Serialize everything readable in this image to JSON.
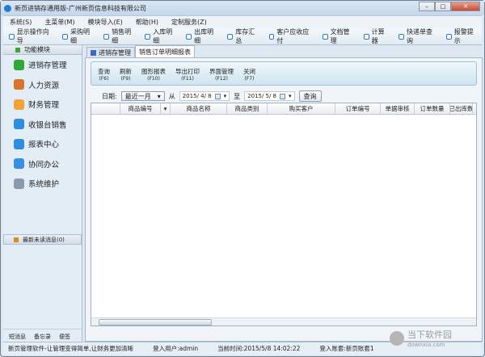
{
  "window": {
    "title": "新页进销存通用版-广州新页信息科技有限公司"
  },
  "menu": [
    "系统(S)",
    "主菜单(M)",
    "模块导入(E)",
    "帮助(H)",
    "定制服务(Z)"
  ],
  "toolbar": [
    "显示操作向导",
    "采购明细",
    "销售明细",
    "入库明细",
    "出库明细",
    "库存汇总",
    "客户应收应付",
    "文档管理",
    "计算器",
    "快递单查询",
    "报警提示"
  ],
  "sidebar": {
    "header": "功能模块",
    "items": [
      {
        "label": "进销存管理",
        "color": "#2fa936"
      },
      {
        "label": "人力资源",
        "color": "#d9742a"
      },
      {
        "label": "财务管理",
        "color": "#f2a33a"
      },
      {
        "label": "收银台销售",
        "color": "#2f8ee0"
      },
      {
        "label": "报表中心",
        "color": "#2f8ee0"
      },
      {
        "label": "协同办公",
        "color": "#3b8fe0"
      },
      {
        "label": "系统维护",
        "color": "#8a9bb0"
      }
    ],
    "messages": "最新未读消息(0)",
    "bottom_links": [
      "短消息",
      "备忘录",
      "便签"
    ]
  },
  "tabs": [
    "进销存管理",
    "销售订单明细报表"
  ],
  "ribbon": [
    {
      "label": "查询",
      "key": "(F6)"
    },
    {
      "label": "刷新",
      "key": "(F9)"
    },
    {
      "label": "图形报表",
      "key": "(F10)"
    },
    {
      "label": "导出打印",
      "key": "(F11)"
    },
    {
      "label": "界面管理",
      "key": "(F12)"
    },
    {
      "label": "关闭",
      "key": "(F7)"
    }
  ],
  "filter": {
    "date_label": "日期:",
    "range": "最近一月",
    "from_label": "从",
    "from": "2015/ 4/ 8",
    "to_label": "至",
    "to": "2015/ 5/ 8",
    "query": "查询"
  },
  "grid": {
    "columns": [
      "",
      "商品编号",
      "▾",
      "商品名称",
      "商品类别",
      "购买客户",
      "订单编号",
      "单据审核",
      "订单数量",
      "已出库数"
    ]
  },
  "status": {
    "slogan": "新页管理软件-让管理变得简单,让财务更加清晰",
    "user": "登入用户:admin",
    "time": "当前时间:2015/5/8 14:02:22",
    "account": "登入账套:新页账套1"
  },
  "watermark": {
    "text": "当下软件园",
    "url": "downxia.com"
  }
}
